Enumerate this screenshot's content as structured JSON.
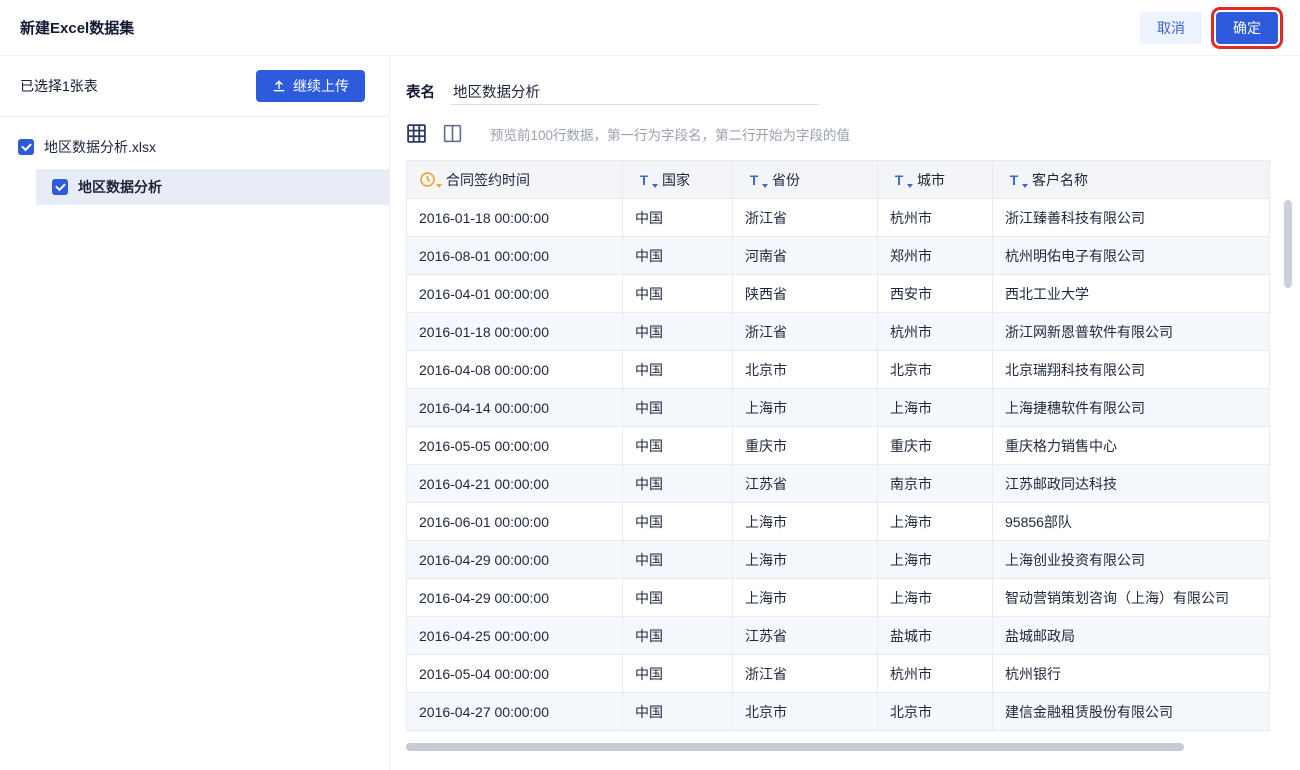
{
  "header": {
    "title": "新建Excel数据集",
    "cancel_label": "取消",
    "confirm_label": "确定"
  },
  "sidebar": {
    "selected_count_text": "已选择1张表",
    "upload_button_label": "继续上传",
    "file_item": "地区数据分析.xlsx",
    "sheet_item": "地区数据分析"
  },
  "main": {
    "table_name_label": "表名",
    "table_name_value": "地区数据分析",
    "preview_hint": "预览前100行数据，第一行为字段名，第二行开始为字段的值"
  },
  "table": {
    "columns": [
      {
        "label": "合同签约时间",
        "type": "date",
        "icon": "clock-icon"
      },
      {
        "label": "国家",
        "type": "text",
        "icon": "text-filter-icon"
      },
      {
        "label": "省份",
        "type": "text",
        "icon": "text-filter-icon"
      },
      {
        "label": "城市",
        "type": "text",
        "icon": "text-filter-icon"
      },
      {
        "label": "客户名称",
        "type": "text",
        "icon": "text-filter-icon"
      }
    ],
    "rows": [
      [
        "2016-01-18 00:00:00",
        "中国",
        "浙江省",
        "杭州市",
        "浙江臻善科技有限公司"
      ],
      [
        "2016-08-01 00:00:00",
        "中国",
        "河南省",
        "郑州市",
        "杭州明佑电子有限公司"
      ],
      [
        "2016-04-01 00:00:00",
        "中国",
        "陕西省",
        "西安市",
        "西北工业大学"
      ],
      [
        "2016-01-18 00:00:00",
        "中国",
        "浙江省",
        "杭州市",
        "浙江网新恩普软件有限公司"
      ],
      [
        "2016-04-08 00:00:00",
        "中国",
        "北京市",
        "北京市",
        "北京瑞翔科技有限公司"
      ],
      [
        "2016-04-14 00:00:00",
        "中国",
        "上海市",
        "上海市",
        "上海捷穗软件有限公司"
      ],
      [
        "2016-05-05 00:00:00",
        "中国",
        "重庆市",
        "重庆市",
        "重庆格力销售中心"
      ],
      [
        "2016-04-21 00:00:00",
        "中国",
        "江苏省",
        "南京市",
        "江苏邮政同达科技"
      ],
      [
        "2016-06-01 00:00:00",
        "中国",
        "上海市",
        "上海市",
        "95856部队"
      ],
      [
        "2016-04-29 00:00:00",
        "中国",
        "上海市",
        "上海市",
        "上海创业投资有限公司"
      ],
      [
        "2016-04-29 00:00:00",
        "中国",
        "上海市",
        "上海市",
        "智动营销策划咨询（上海）有限公司"
      ],
      [
        "2016-04-25 00:00:00",
        "中国",
        "江苏省",
        "盐城市",
        "盐城邮政局"
      ],
      [
        "2016-05-04 00:00:00",
        "中国",
        "浙江省",
        "杭州市",
        "杭州银行"
      ],
      [
        "2016-04-27 00:00:00",
        "中国",
        "北京市",
        "北京市",
        "建信金融租赁股份有限公司"
      ]
    ]
  },
  "colors": {
    "primary_blue": "#2e5bdc",
    "cancel_bg": "#ecf2fe",
    "annotation_red": "#e02a2a",
    "table_header_bg": "#f3f5f9",
    "row_alt_bg": "#f5f8fd",
    "sheet_highlight_bg": "#e7ecf7"
  }
}
